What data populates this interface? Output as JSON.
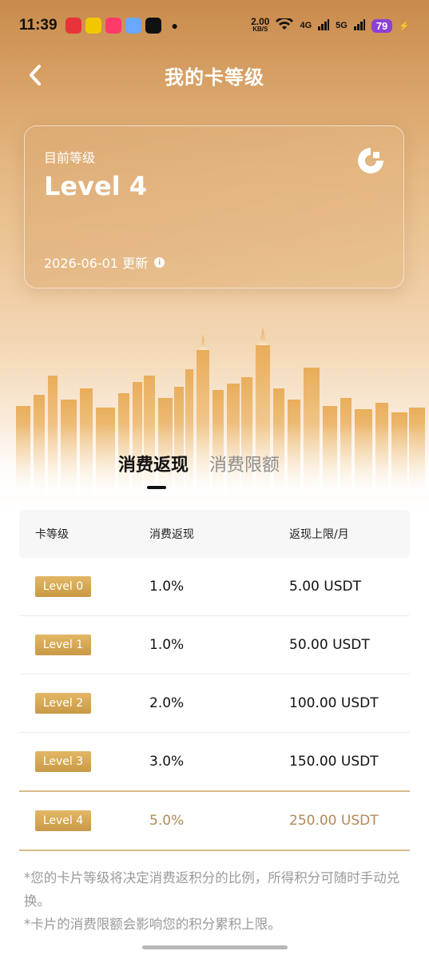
{
  "status_bar": {
    "time": "11:39",
    "net_speed": "2.00",
    "net_unit": "KB/S",
    "signal_1": "4G",
    "signal_2": "5G",
    "battery": "79"
  },
  "nav": {
    "title": "我的卡等级"
  },
  "level_card": {
    "label": "目前等级",
    "level": "Level 4",
    "updated": "2026-06-01 更新"
  },
  "tabs": [
    {
      "label": "消费返现",
      "active": true
    },
    {
      "label": "消费限额",
      "active": false
    }
  ],
  "table": {
    "headers": [
      "卡等级",
      "消费返现",
      "返现上限/月"
    ],
    "rows": [
      {
        "level": "Level 0",
        "rate": "1.0%",
        "cap": "5.00 USDT"
      },
      {
        "level": "Level 1",
        "rate": "1.0%",
        "cap": "50.00 USDT"
      },
      {
        "level": "Level 2",
        "rate": "2.0%",
        "cap": "100.00 USDT"
      },
      {
        "level": "Level 3",
        "rate": "3.0%",
        "cap": "150.00 USDT"
      },
      {
        "level": "Level 4",
        "rate": "5.0%",
        "cap": "250.00 USDT"
      }
    ]
  },
  "notes": [
    "*您的卡片等级将决定消费返积分的比例，所得积分可随时手动兑换。",
    "*卡片的消费限额会影响您的积分累积上限。"
  ],
  "colors": {
    "gold": "#d7a55a",
    "current_text": "#b08a5a",
    "current_border": "#d8b98c",
    "battery": "#8c3fd6"
  }
}
